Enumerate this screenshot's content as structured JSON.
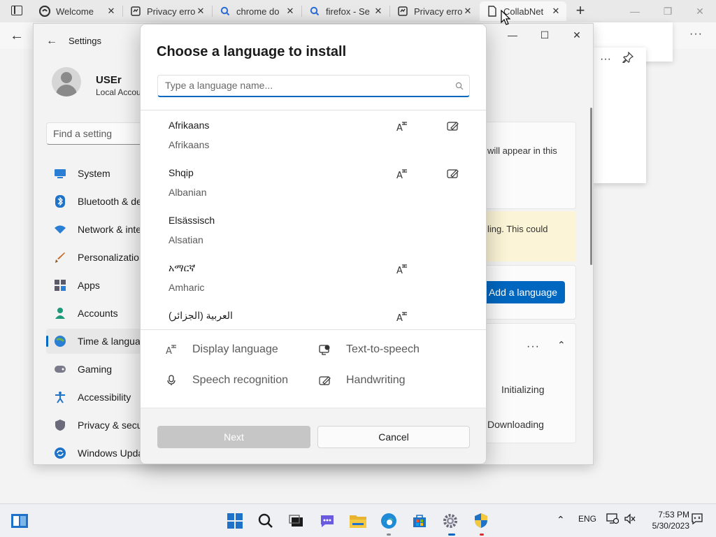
{
  "browser": {
    "tabs": [
      {
        "label": "Welcome",
        "icon": "edge-logo-icon"
      },
      {
        "label": "Privacy erro",
        "icon": "privacy-error-icon"
      },
      {
        "label": "chrome do",
        "icon": "search-icon"
      },
      {
        "label": "firefox - Se",
        "icon": "search-icon"
      },
      {
        "label": "Privacy erro",
        "icon": "privacy-error-icon"
      },
      {
        "label": "CollabNet",
        "icon": "page-icon"
      }
    ],
    "new_tab": "+",
    "more": "···"
  },
  "settings": {
    "title": "Settings",
    "user_name": "USEr",
    "user_sub": "Local Accou",
    "search_placeholder": "Find a setting",
    "nav": [
      {
        "label": "System",
        "icon": "system-icon"
      },
      {
        "label": "Bluetooth & de",
        "icon": "bluetooth-icon"
      },
      {
        "label": "Network & inte",
        "icon": "network-icon"
      },
      {
        "label": "Personalization",
        "icon": "personalization-icon"
      },
      {
        "label": "Apps",
        "icon": "apps-icon"
      },
      {
        "label": "Accounts",
        "icon": "accounts-icon"
      },
      {
        "label": "Time & langua",
        "icon": "time-language-icon"
      },
      {
        "label": "Gaming",
        "icon": "gaming-icon"
      },
      {
        "label": "Accessibility",
        "icon": "accessibility-icon"
      },
      {
        "label": "Privacy & secu",
        "icon": "privacy-security-icon"
      },
      {
        "label": "Windows Upda",
        "icon": "windows-update-icon"
      }
    ],
    "right": {
      "appear_text": "will appear in this",
      "warn_text": "ling. This could",
      "add_language": "Add a language",
      "initializing": "Initializing",
      "downloading": "Downloading",
      "more": "···"
    }
  },
  "dialog": {
    "title": "Choose a language to install",
    "search_placeholder": "Type a language name...",
    "languages": [
      {
        "native": "Afrikaans",
        "english": "Afrikaans",
        "display": true,
        "handwriting": true
      },
      {
        "native": "Shqip",
        "english": "Albanian",
        "display": true,
        "handwriting": true
      },
      {
        "native": "Elsässisch",
        "english": "Alsatian",
        "display": false,
        "handwriting": false
      },
      {
        "native": "አማርኛ",
        "english": "Amharic",
        "display": true,
        "handwriting": false
      },
      {
        "native": "العربية (الجزائر)",
        "english": "",
        "display": true,
        "handwriting": false
      }
    ],
    "legend": {
      "display_language": "Display language",
      "text_to_speech": "Text-to-speech",
      "speech_recognition": "Speech recognition",
      "handwriting": "Handwriting"
    },
    "next_label": "Next",
    "cancel_label": "Cancel"
  },
  "taskbar": {
    "language": "ENG",
    "time": "7:53 PM",
    "date": "5/30/2023"
  },
  "colors": {
    "accent": "#0067c0",
    "warning_bg": "#fcf4d6",
    "disabled_button": "#c6c6c6"
  }
}
